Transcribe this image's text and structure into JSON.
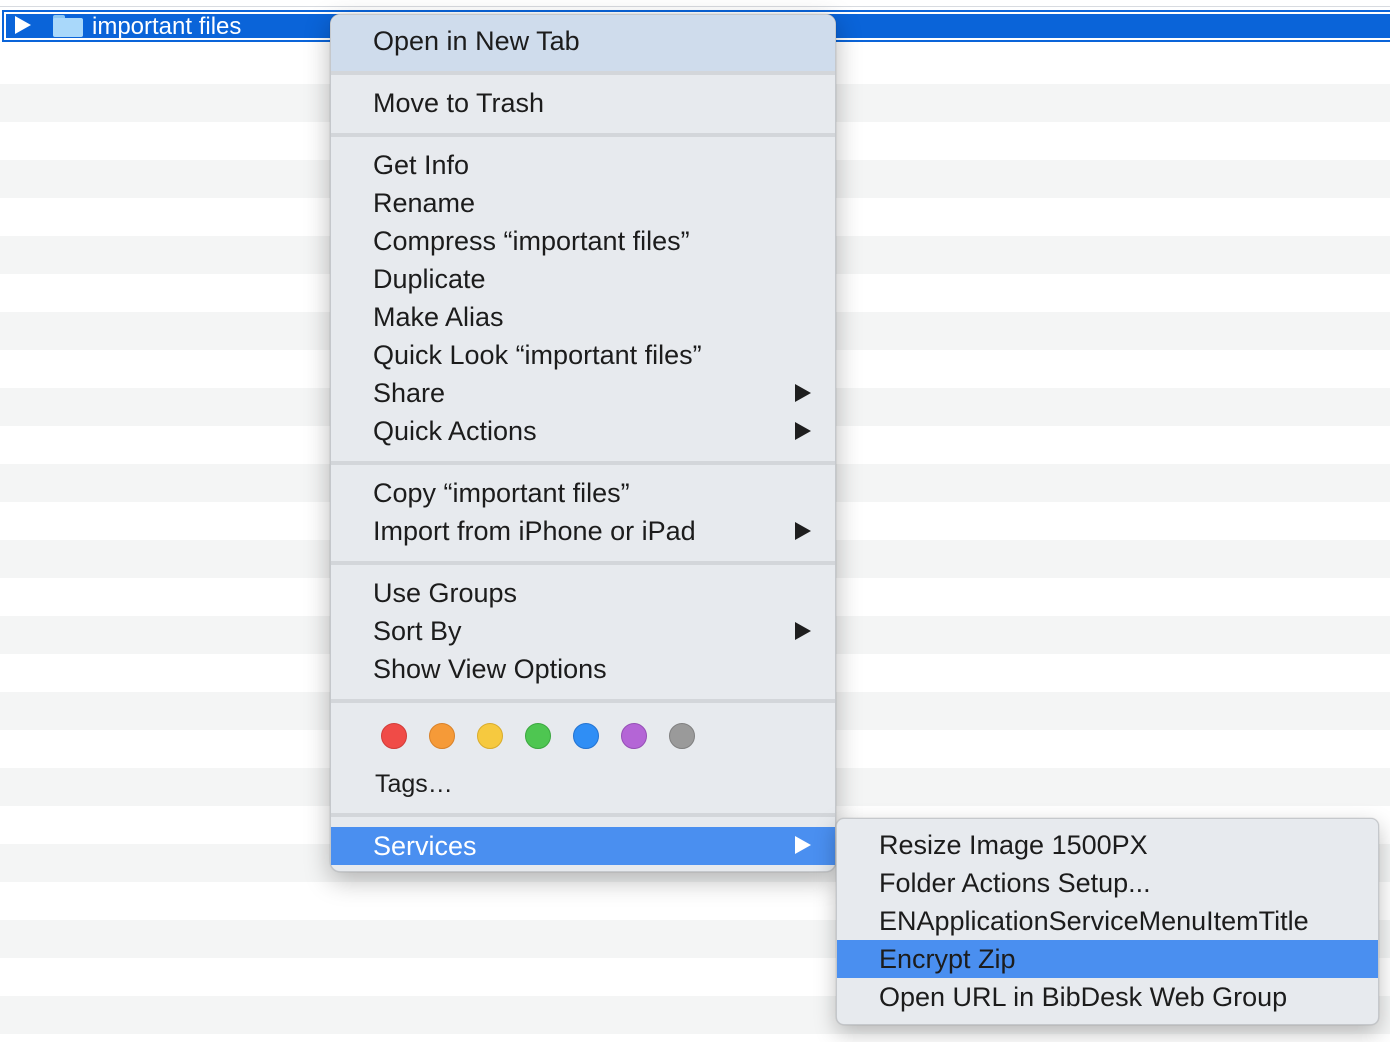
{
  "finder": {
    "selected_item": "important files"
  },
  "context_menu": {
    "open_new_tab": "Open in New Tab",
    "move_to_trash": "Move to Trash",
    "get_info": "Get Info",
    "rename": "Rename",
    "compress": "Compress “important files”",
    "duplicate": "Duplicate",
    "make_alias": "Make Alias",
    "quick_look": "Quick Look “important files”",
    "share": "Share",
    "quick_actions": "Quick Actions",
    "copy": "Copy “important files”",
    "import_iphone": "Import from iPhone or iPad",
    "use_groups": "Use Groups",
    "sort_by": "Sort By",
    "show_view_options": "Show View Options",
    "tags": "Tags…",
    "services": "Services",
    "tag_colors": [
      "#f04b47",
      "#f59a38",
      "#f6c93f",
      "#4ec651",
      "#2f8ef5",
      "#b465d6",
      "#9a9a9a"
    ]
  },
  "services_submenu": {
    "resize_image": "Resize Image 1500PX",
    "folder_actions": "Folder Actions Setup...",
    "en_service": "ENApplicationServiceMenuItemTitle",
    "encrypt_zip": "Encrypt Zip",
    "open_url_bibdesk": "Open URL in BibDesk Web Group"
  }
}
